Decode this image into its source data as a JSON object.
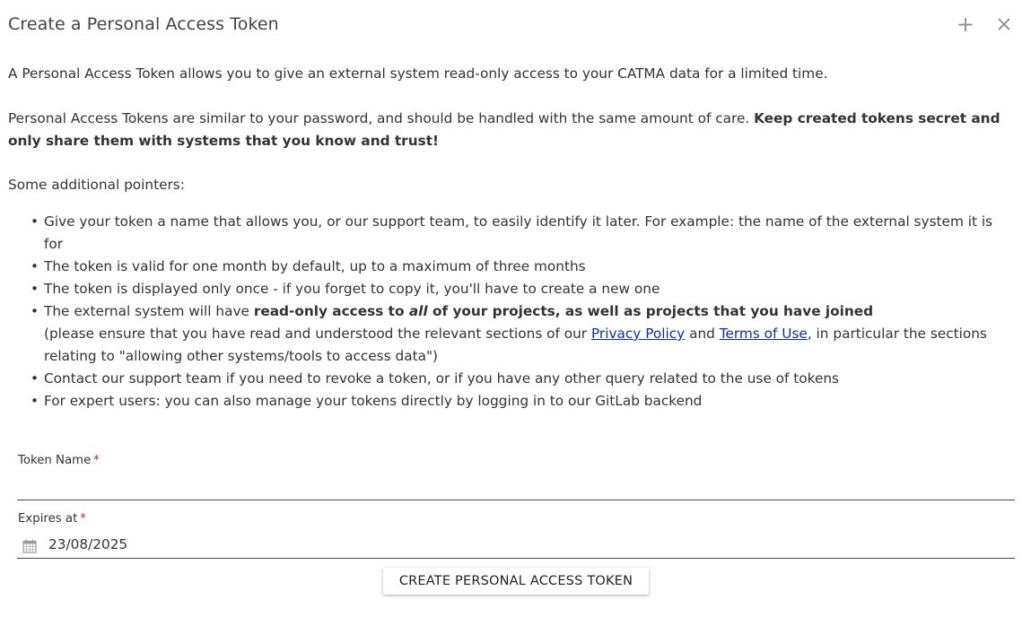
{
  "dialog": {
    "title": "Create a Personal Access Token",
    "add_icon": "plus-icon",
    "close_icon": "close-icon"
  },
  "intro": {
    "p1": "A Personal Access Token allows you to give an external system read-only access to your CATMA data for a limited time.",
    "p2_plain": "Personal Access Tokens are similar to your password, and should be handled with the same amount of care. ",
    "p2_bold": "Keep created tokens secret and only share them with systems that you know and trust!",
    "p3": "Some additional pointers:"
  },
  "pointers": {
    "bullet": "•",
    "item1": "Give your token a name that allows you, or our support team, to easily identify it later. For example: the name of the external system it is for",
    "item2": "The token is valid for one month by default, up to a maximum of three months",
    "item3": "The token is displayed only once - if you forget to copy it, you'll have to create a new one",
    "item4_plain": "The external system will have ",
    "item4_bold1": "read-only access to ",
    "item4_bold_italic": "all",
    "item4_bold2": " of your projects, as well as projects that you have joined",
    "item4_note_pre": "(please ensure that you have read and understood the relevant sections of our ",
    "privacy_link": "Privacy Policy",
    "item4_note_and": " and ",
    "terms_link": "Terms of Use",
    "item4_note_post": ", in particular the sections relating to \"allowing other systems/tools to access data\")",
    "item5": "Contact our support team if you need to revoke a token, or if you have any other query related to the use of tokens",
    "item6": "For expert users: you can also manage your tokens directly by logging in to our GitLab backend"
  },
  "form": {
    "token_name_label": "Token Name",
    "token_name_value": "",
    "required_mark": "*",
    "expires_label": "Expires at",
    "expires_value": "23/08/2025",
    "calendar_icon": "calendar-icon",
    "create_button": "CREATE PERSONAL ACCESS TOKEN"
  },
  "colors": {
    "required": "#c62828",
    "link": "#0b2eb5"
  }
}
